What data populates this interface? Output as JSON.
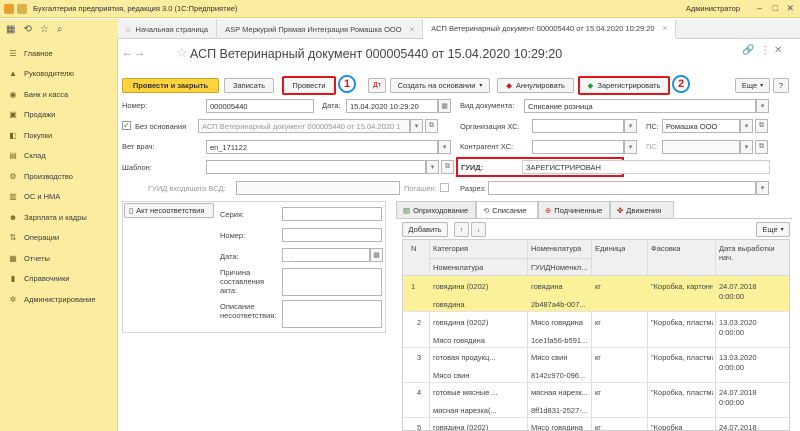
{
  "window": {
    "title": "Бухгалтерия предприятия, редакция 3.0  (1С:Предприятие)",
    "user": "Администратор"
  },
  "tabs": [
    {
      "label": "Начальная страница"
    },
    {
      "label": "ASP Меркурий Прямая Интеграция Ромашка ООО"
    },
    {
      "label": "АСП Ветеринарный документ 000005440 от 15.04.2020 10:29:20"
    }
  ],
  "sidebar": {
    "items": [
      {
        "label": "Главное",
        "icon": "hamburger-icon"
      },
      {
        "label": "Руководителю",
        "icon": "chart-icon"
      },
      {
        "label": "Банк и касса",
        "icon": "coin-icon"
      },
      {
        "label": "Продажи",
        "icon": "cart-icon"
      },
      {
        "label": "Покупки",
        "icon": "bag-icon"
      },
      {
        "label": "Склад",
        "icon": "warehouse-icon"
      },
      {
        "label": "Производство",
        "icon": "factory-icon"
      },
      {
        "label": "ОС и НМА",
        "icon": "building-icon"
      },
      {
        "label": "Зарплата и кадры",
        "icon": "people-icon"
      },
      {
        "label": "Операции",
        "icon": "operations-icon"
      },
      {
        "label": "Отчеты",
        "icon": "report-icon"
      },
      {
        "label": "Справочники",
        "icon": "book-icon"
      },
      {
        "label": "Администрирование",
        "icon": "gear-icon"
      }
    ]
  },
  "doc": {
    "title": "АСП Ветеринарный документ 000005440 от 15.04.2020 10:29:20"
  },
  "toolbar": {
    "post_close": "Провести и закрыть",
    "save": "Записать",
    "post": "Провести",
    "create_based": "Создать на основании",
    "cancel": "Аннулировать",
    "register": "Зарегистрировать",
    "more": "Еще",
    "help": "?",
    "marker1": "1",
    "marker2": "2"
  },
  "form": {
    "number_label": "Номер:",
    "number_value": "000005440",
    "date_label": "Дата:",
    "date_value": "15.04.2020 10:29:20",
    "doctype_label": "Вид документа:",
    "doctype_value": "Списание розница",
    "nobasis_label": "Без основания",
    "nobasis_value": "АСП Ветеринарный документ 000005440 от 15.04.2020 1",
    "org_label": "Организация ХС:",
    "org_value": "",
    "ps_label": "ПС:",
    "ps_value": "Ромашка ООО",
    "vet_label": "Вет врач:",
    "vet_value": "en_171122",
    "contractor_label": "Контрагент ХС:",
    "contractor_value": "",
    "ps2_label": "ПС:",
    "template_label": "Шаблон:",
    "template_value": "",
    "guid_label": "ГУИД:",
    "guid_value": "ЗАРЕГИСТРИРОВАН",
    "incoming_label": "ГУИД входящего ВСД:",
    "extinguished_label": "Погашен:",
    "split_label": "Разрез:"
  },
  "act": {
    "button": "Акт несоответствия",
    "series_label": "Серия:",
    "number_label": "Номер:",
    "date_label": "Дата:",
    "date_value": " .  .",
    "reason_label": "Причина составления акта:",
    "description_label": "Описание несоответствия:"
  },
  "inner_tabs": [
    {
      "label": "Оприходование"
    },
    {
      "label": "Списание"
    },
    {
      "label": "Подчиненные"
    },
    {
      "label": "Движения"
    }
  ],
  "table": {
    "add": "Добавить",
    "more": "Еще",
    "headers": {
      "n": "N",
      "category": "Категория",
      "nomenclature": "Номенклатура",
      "unit": "Единица",
      "packing": "Фасовка",
      "date": "Дата выработки нач.",
      "sub_nomenclature": "Номенклатура",
      "sub_guid": "ГУИДНоменкл..."
    },
    "rows": [
      {
        "n": "1",
        "category": "говядина (0202)",
        "nom": "говядина",
        "unit": "кг",
        "packing": "\"Коробка, картонн...",
        "date": "24.07.2018",
        "time": "0:00:00",
        "sub_nom": "говядина",
        "sub_guid": "2b487a4b-007..."
      },
      {
        "n": "2",
        "category": "говядина (0202)",
        "nom": "Мясо говядина",
        "unit": "кг",
        "packing": "\"Коробка, пластма...",
        "date": "13.03.2020",
        "time": "0:00:00",
        "sub_nom": "Мясо говядина",
        "sub_guid": "1ce1fa56-b591..."
      },
      {
        "n": "3",
        "category": "готовая продукц...",
        "nom": "Мясо свин",
        "unit": "кг",
        "packing": "\"Коробка, пластма...",
        "date": "13.03.2020",
        "time": "0:00:00",
        "sub_nom": "Мясо свин",
        "sub_guid": "8142c970-096..."
      },
      {
        "n": "4",
        "category": "готовые мясные ...",
        "nom": "мясная нарезк...",
        "unit": "кг",
        "packing": "\"Коробка, пластма...",
        "date": "24.07.2018",
        "time": "0:00:00",
        "sub_nom": "мясная нарезка(...",
        "sub_guid": "8ff1d831-2527-..."
      },
      {
        "n": "5",
        "category": "говядина (0202)",
        "nom": "Мясо говядина",
        "unit": "кг",
        "packing": "\"Коробка",
        "date": "24.07.2018",
        "time": "",
        "sub_nom": "",
        "sub_guid": ""
      }
    ]
  }
}
